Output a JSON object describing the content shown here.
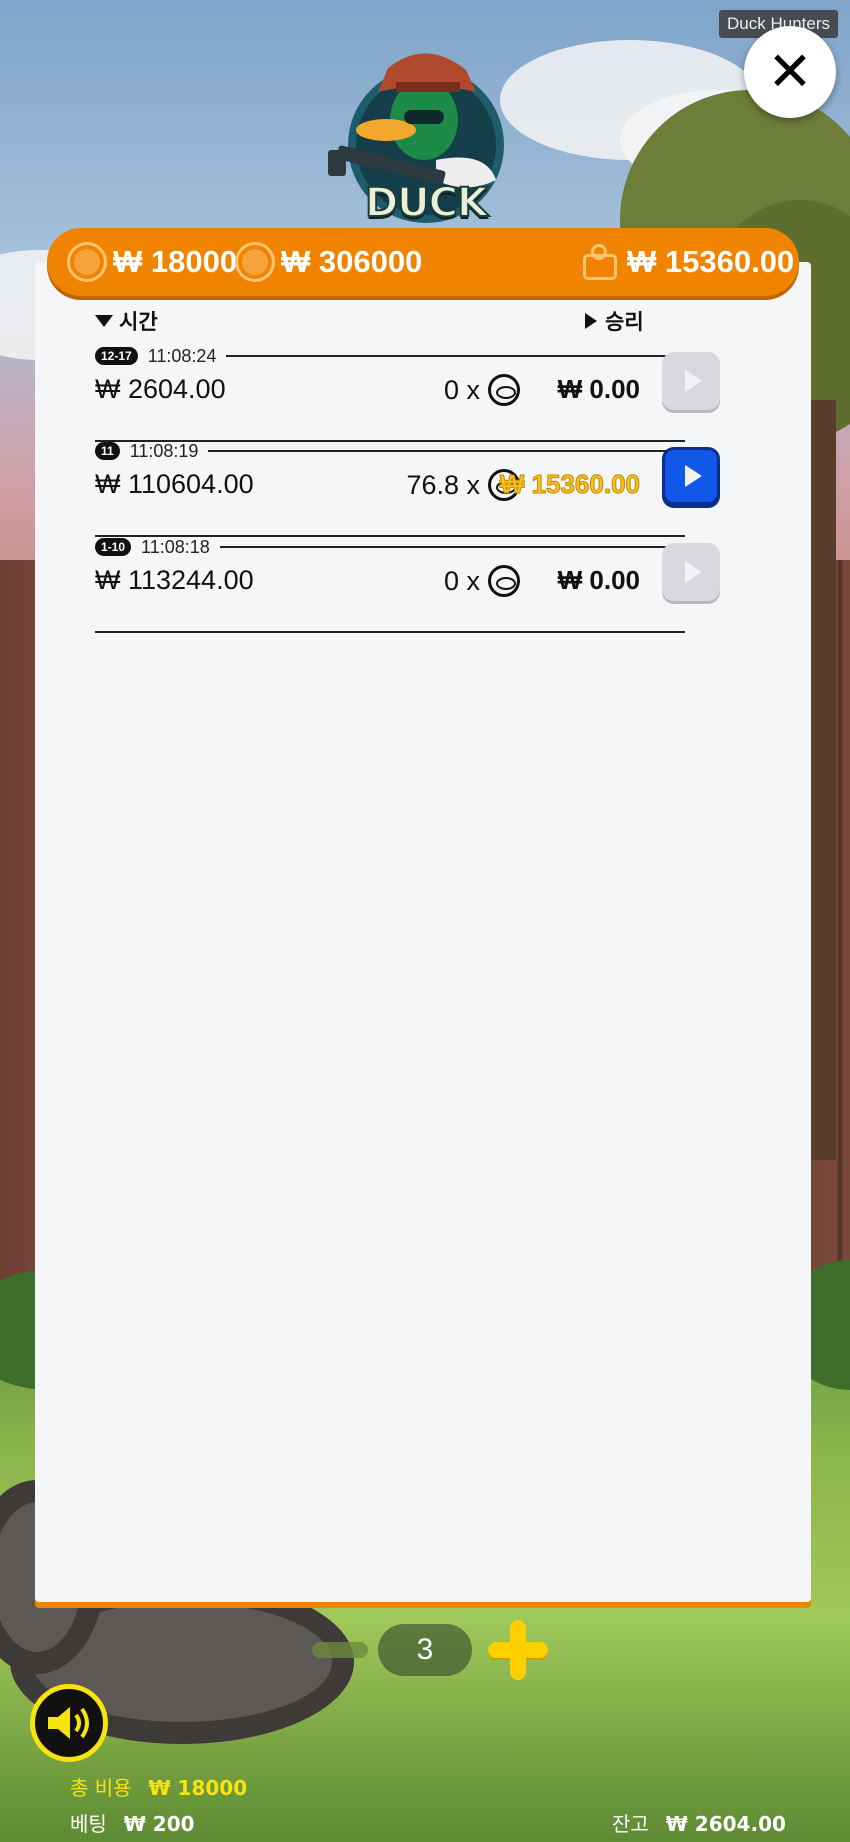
{
  "window_label": "Duck Hunters",
  "logo_text": "DUCK HUNTERS",
  "info_bar": {
    "bet_total": "₩ 18000",
    "max_win": "₩ 306000",
    "balance": "₩ 15360.00"
  },
  "history": {
    "col_time": "시간",
    "col_win": "승리",
    "rows": [
      {
        "round": "12-17",
        "time": "11:08:24",
        "cost": "₩ 2604.00",
        "mult": "0 x",
        "win": "₩ 0.00",
        "highlight": false
      },
      {
        "round": "11",
        "time": "11:08:19",
        "cost": "₩ 110604.00",
        "mult": "76.8 x",
        "win": "₩ 15360.00",
        "highlight": true
      },
      {
        "round": "1-10",
        "time": "11:08:18",
        "cost": "₩ 113244.00",
        "mult": "0 x",
        "win": "₩ 0.00",
        "highlight": false
      }
    ]
  },
  "stepper": {
    "value": "3"
  },
  "footer": {
    "total_cost_label": "총 비용",
    "total_cost_value": "₩ 18000",
    "bet_label": "베팅",
    "bet_value": "₩ 200",
    "balance_label": "잔고",
    "balance_value": "₩ 2604.00"
  },
  "icons": {
    "close": "close-icon",
    "coin": "coin-icon",
    "wallet": "wallet-icon",
    "play": "play-icon",
    "sound": "speaker-icon"
  },
  "colors": {
    "accent_orange": "#f08300",
    "win_gold": "#f8c21e",
    "play_blue": "#1157e8",
    "sound_ring": "#f7e40e"
  }
}
